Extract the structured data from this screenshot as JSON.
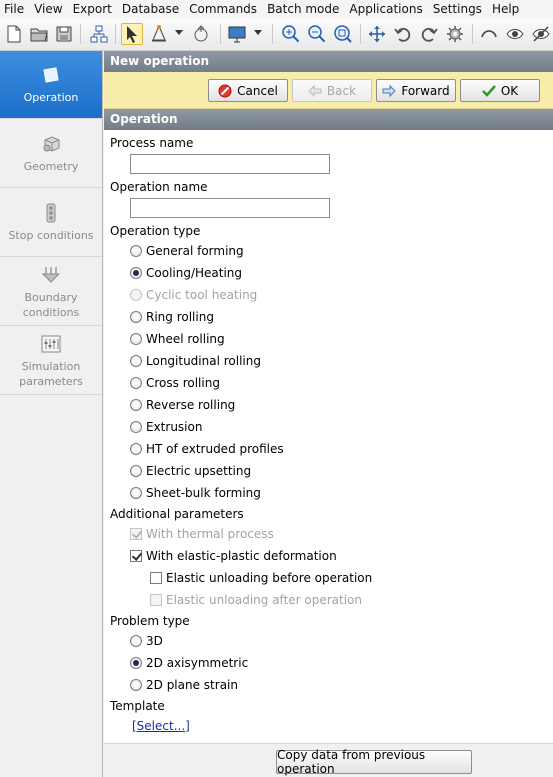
{
  "menu": [
    "File",
    "View",
    "Export",
    "Database",
    "Commands",
    "Batch mode",
    "Applications",
    "Settings",
    "Help"
  ],
  "toolbar": {
    "icons": [
      "new-file-icon",
      "open-folder-icon",
      "save-icon",
      "tree-icon",
      "select-arrow-icon",
      "measure-icon",
      "rotate-point-icon",
      "monitor-icon",
      "zoom-in-icon",
      "zoom-out-icon",
      "zoom-fit-icon",
      "pan-icon",
      "undo-icon",
      "redo-icon",
      "gear-icon",
      "curve-icon",
      "eye-icon",
      "eye-strike-icon"
    ]
  },
  "nav": [
    {
      "label": "Operation",
      "icon": "square-icon",
      "active": true
    },
    {
      "label": "Geometry",
      "icon": "cube-icon",
      "active": false
    },
    {
      "label": "Stop conditions",
      "icon": "traffic-light-icon",
      "active": false
    },
    {
      "label": "Boundary\nconditions",
      "icon": "arrows-down-icon",
      "active": false
    },
    {
      "label": "Simulation\nparameters",
      "icon": "sliders-icon",
      "active": false
    }
  ],
  "panel": {
    "title": "New operation",
    "buttons": {
      "cancel": "Cancel",
      "back": "Back",
      "forward": "Forward",
      "ok": "OK"
    },
    "section_title": "Operation",
    "process_name_label": "Process name",
    "process_name_value": "",
    "operation_name_label": "Operation name",
    "operation_name_value": "",
    "operation_type_label": "Operation type",
    "operation_types": [
      {
        "label": "General forming",
        "checked": false,
        "disabled": false
      },
      {
        "label": "Cooling/Heating",
        "checked": true,
        "disabled": false
      },
      {
        "label": "Cyclic tool heating",
        "checked": false,
        "disabled": true
      },
      {
        "label": "Ring rolling",
        "checked": false,
        "disabled": false
      },
      {
        "label": "Wheel rolling",
        "checked": false,
        "disabled": false
      },
      {
        "label": "Longitudinal rolling",
        "checked": false,
        "disabled": false
      },
      {
        "label": "Cross rolling",
        "checked": false,
        "disabled": false
      },
      {
        "label": "Reverse rolling",
        "checked": false,
        "disabled": false
      },
      {
        "label": "Extrusion",
        "checked": false,
        "disabled": false
      },
      {
        "label": "HT of extruded profiles",
        "checked": false,
        "disabled": false
      },
      {
        "label": "Electric upsetting",
        "checked": false,
        "disabled": false
      },
      {
        "label": "Sheet-bulk forming",
        "checked": false,
        "disabled": false
      }
    ],
    "additional_label": "Additional parameters",
    "additional": [
      {
        "label": "With thermal process",
        "checked": true,
        "disabled": true
      },
      {
        "label": "With elastic-plastic deformation",
        "checked": true,
        "disabled": false
      },
      {
        "label": "Elastic unloading before operation",
        "checked": false,
        "disabled": false
      },
      {
        "label": "Elastic unloading after operation",
        "checked": false,
        "disabled": true
      }
    ],
    "problem_type_label": "Problem type",
    "problem_types": [
      {
        "label": "3D",
        "checked": false
      },
      {
        "label": "2D axisymmetric",
        "checked": true
      },
      {
        "label": "2D plane strain",
        "checked": false
      }
    ],
    "template_label": "Template",
    "template_link": "[Select...]",
    "copy_button": "Copy data from previous operation"
  },
  "colors": {
    "accent": "#1b6fc9",
    "header": "#7f8893",
    "button_bar": "#f7ecaa",
    "link": "#1b2fa8"
  }
}
